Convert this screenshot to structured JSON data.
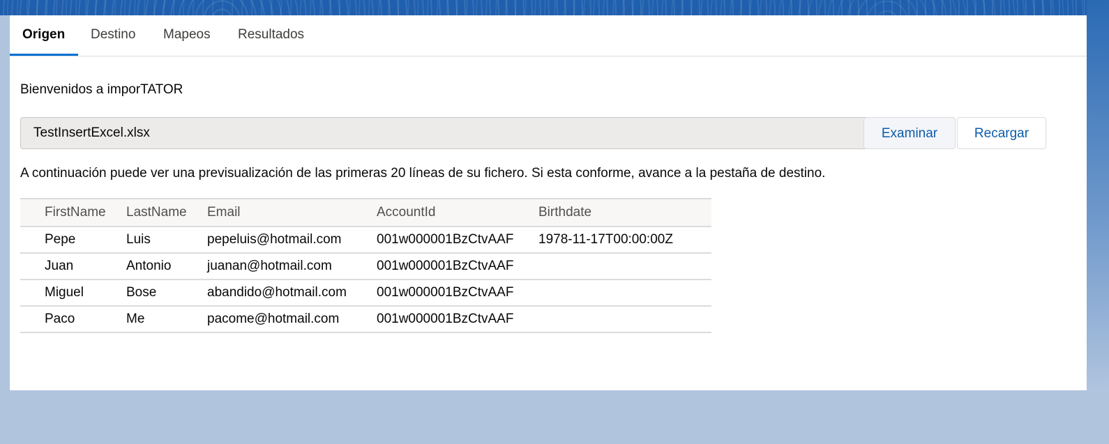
{
  "tabs": [
    {
      "label": "Origen",
      "active": true
    },
    {
      "label": "Destino",
      "active": false
    },
    {
      "label": "Mapeos",
      "active": false
    },
    {
      "label": "Resultados",
      "active": false
    }
  ],
  "welcome_text": "Bienvenidos a imporTATOR",
  "file_input": {
    "value": "TestInsertExcel.xlsx"
  },
  "buttons": {
    "browse_label": "Examinar",
    "reload_label": "Recargar"
  },
  "info_text": "A continuación puede ver una previsualización de las primeras 20 líneas de su fichero. Si esta conforme, avance a la pestaña de destino.",
  "preview_table": {
    "columns": [
      "FirstName",
      "LastName",
      "Email",
      "AccountId",
      "Birthdate"
    ],
    "rows": [
      [
        "Pepe",
        "Luis",
        "pepeluis@hotmail.com",
        "001w000001BzCtvAAF",
        "1978-11-17T00:00:00Z"
      ],
      [
        "Juan",
        "Antonio",
        "juanan@hotmail.com",
        "001w000001BzCtvAAF",
        ""
      ],
      [
        "Miguel",
        "Bose",
        "abandido@hotmail.com",
        "001w000001BzCtvAAF",
        ""
      ],
      [
        "Paco",
        "Me",
        "pacome@hotmail.com",
        "001w000001BzCtvAAF",
        ""
      ]
    ]
  },
  "colors": {
    "accent": "#0070d2",
    "button_text": "#0b5cab",
    "page_background": "#b0c4de"
  }
}
